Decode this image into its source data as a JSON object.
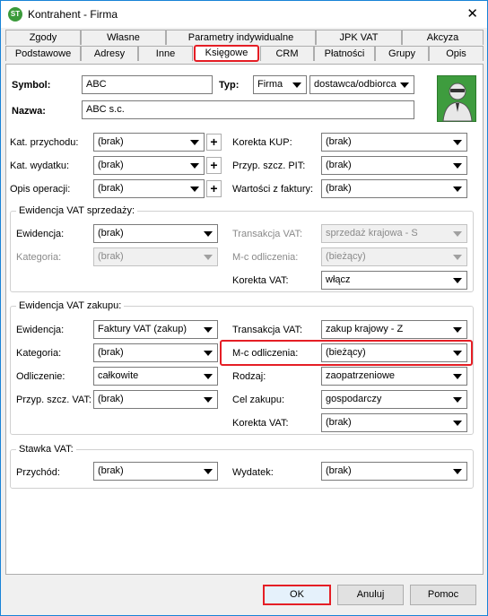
{
  "window": {
    "title": "Kontrahent - Firma",
    "icon": "app-logo-icon",
    "close_icon": "close-icon"
  },
  "tabs": {
    "row1": [
      "Zgody",
      "Własne",
      "Parametry indywidualne",
      "JPK VAT",
      "Akcyza"
    ],
    "row2": [
      "Podstawowe",
      "Adresy",
      "Inne",
      "Księgowe",
      "CRM",
      "Płatności",
      "Grupy",
      "Opis"
    ],
    "active": "Księgowe"
  },
  "header": {
    "symbol_label": "Symbol:",
    "symbol_value": "ABC",
    "typ_label": "Typ:",
    "typ_value": "Firma",
    "typ2_value": "dostawca/odbiorca",
    "nazwa_label": "Nazwa:",
    "nazwa_value": "ABC s.c."
  },
  "general": {
    "kat_przychodu_label": "Kat. przychodu:",
    "kat_przychodu_value": "(brak)",
    "kat_wydatku_label": "Kat. wydatku:",
    "kat_wydatku_value": "(brak)",
    "opis_label": "Opis operacji:",
    "opis_value": "(brak)",
    "korekta_kup_label": "Korekta KUP:",
    "korekta_kup_value": "(brak)",
    "przyp_pit_label": "Przyp. szcz. PIT:",
    "przyp_pit_value": "(brak)",
    "wartosci_label": "Wartości z faktury:",
    "wartosci_value": "(brak)"
  },
  "sprzedaz": {
    "title": "Ewidencja VAT sprzedaży:",
    "ewidencja_label": "Ewidencja:",
    "ewidencja_value": "(brak)",
    "kategoria_label": "Kategoria:",
    "kategoria_value": "(brak)",
    "transakcja_label": "Transakcja VAT:",
    "transakcja_value": "sprzedaż krajowa - S",
    "mc_label": "M-c odliczenia:",
    "mc_value": "(bieżący)",
    "korekta_label": "Korekta VAT:",
    "korekta_value": "włącz"
  },
  "zakup": {
    "title": "Ewidencja VAT zakupu:",
    "ewidencja_label": "Ewidencja:",
    "ewidencja_value": "Faktury VAT (zakup)",
    "kategoria_label": "Kategoria:",
    "kategoria_value": "(brak)",
    "odliczenie_label": "Odliczenie:",
    "odliczenie_value": "całkowite",
    "przyp_vat_label": "Przyp. szcz. VAT:",
    "przyp_vat_value": "(brak)",
    "transakcja_label": "Transakcja VAT:",
    "transakcja_value": "zakup krajowy - Z",
    "mc_label": "M-c odliczenia:",
    "mc_value": "(bieżący)",
    "rodzaj_label": "Rodzaj:",
    "rodzaj_value": "zaopatrzeniowe",
    "cel_label": "Cel zakupu:",
    "cel_value": "gospodarczy",
    "korekta_label": "Korekta VAT:",
    "korekta_value": "(brak)"
  },
  "stawka": {
    "title": "Stawka VAT:",
    "przychod_label": "Przychód:",
    "przychod_value": "(brak)",
    "wydatek_label": "Wydatek:",
    "wydatek_value": "(brak)"
  },
  "footer": {
    "ok": "OK",
    "anuluj": "Anuluj",
    "pomoc": "Pomoc"
  },
  "colors": {
    "highlight": "#e51e25",
    "avatar_bg": "#3e9c3e",
    "window_border": "#1883d7"
  }
}
